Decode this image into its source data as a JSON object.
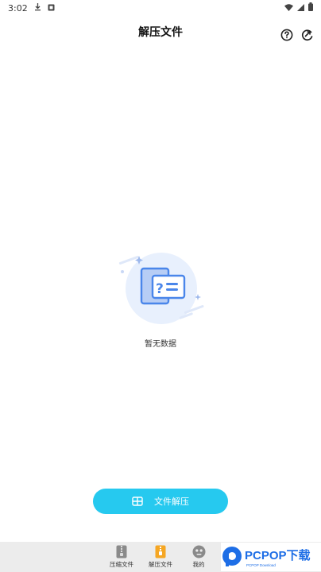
{
  "status_bar": {
    "time": "3:02",
    "icons": [
      "download-icon",
      "notification-icon",
      "wifi-icon",
      "signal-icon",
      "battery-icon"
    ]
  },
  "header": {
    "title": "解压文件",
    "help_icon": "question-circle-icon",
    "share_icon": "share-icon"
  },
  "empty_state": {
    "text": "暂无数据",
    "illustration": "empty-document-icon"
  },
  "extract_button": {
    "label": "文件解压",
    "icon": "archive-icon"
  },
  "bottom_nav": {
    "items": [
      {
        "label": "压缩文件",
        "icon": "zip-icon",
        "active": false
      },
      {
        "label": "解压文件",
        "icon": "unzip-icon",
        "active": true
      },
      {
        "label": "我的",
        "icon": "face-icon",
        "active": false
      }
    ]
  },
  "watermark": {
    "brand": "PCPOP下载",
    "sub": "PCPOP Download"
  },
  "colors": {
    "accent": "#26c9ef",
    "active_nav": "#f5a623",
    "illustration_blue": "#4a86ea",
    "illustration_bg": "#e8f0fd"
  }
}
